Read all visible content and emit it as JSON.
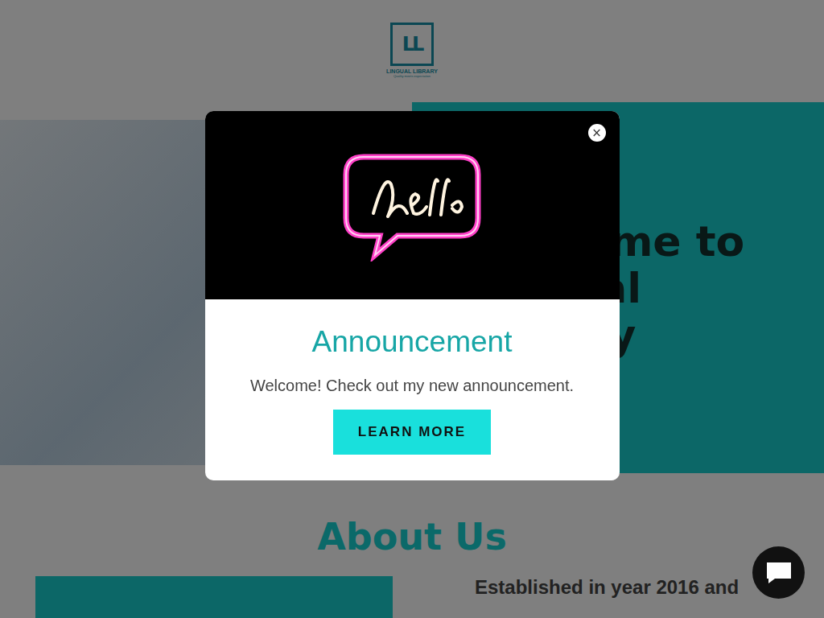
{
  "logo": {
    "mark": "LL",
    "name": "LINGUAL LIBRARY",
    "tagline": "Quality meets expectation"
  },
  "hero": {
    "heading": "Welcome to Lingual Library"
  },
  "about": {
    "heading": "About Us",
    "text": "Established in year 2016 and"
  },
  "popup": {
    "title": "Announcement",
    "message": "Welcome! Check out my new announcement.",
    "button": "LEARN MORE",
    "close": "×"
  }
}
